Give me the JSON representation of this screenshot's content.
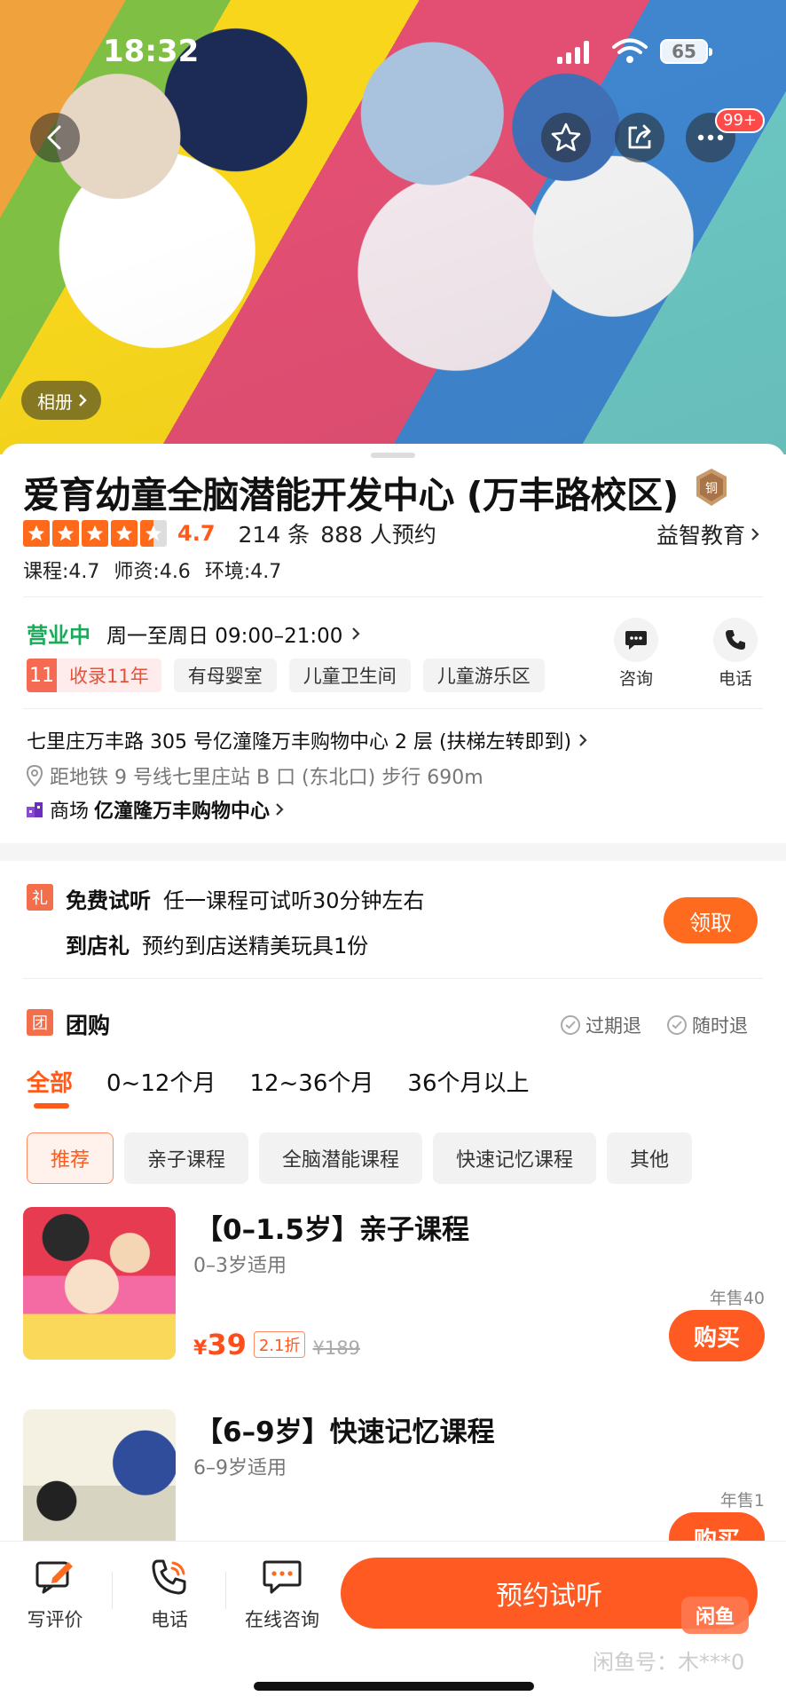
{
  "status_bar": {
    "time": "18:32",
    "battery": "65"
  },
  "header": {
    "notification_badge": "99+",
    "album_label": "相册"
  },
  "shop": {
    "name": "爱育幼童全脑潜能开发中心 (万丰路校区)",
    "medal_label": "铜",
    "rating": "4.7",
    "rating_stars": 4.5,
    "reviews": "214 条",
    "bookings": "888 人预约",
    "category": "益智教育",
    "sub_scores": [
      "课程:4.7",
      "师资:4.6",
      "环境:4.7"
    ],
    "open_status": "营业中",
    "hours": "周一至周日 09:00–21:00",
    "years_num": "11",
    "years_label": "收录11年",
    "tags": [
      "有母婴室",
      "儿童卫生间",
      "儿童游乐区"
    ],
    "consult_label": "咨询",
    "phone_label": "电话",
    "address": "七里庄万丰路 305 号亿潼隆万丰购物中心 2 层 (扶梯左转即到)",
    "subway": "距地铁 9 号线七里庄站 B 口 (东北口) 步行 690m",
    "mall_prefix": "商场",
    "mall_name": "亿潼隆万丰购物中心"
  },
  "promos": {
    "icon_label": "礼",
    "trial_title": "免费试听",
    "trial_desc": "任一课程可试听30分钟左右",
    "gift_title": "到店礼",
    "gift_desc": "预约到店送精美玩具1份",
    "claim_label": "领取"
  },
  "group_buy": {
    "icon_label": "团",
    "title": "团购",
    "guarantee_1": "过期退",
    "guarantee_2": "随时退",
    "age_tabs": [
      "全部",
      "0~12个月",
      "12~36个月",
      "36个月以上"
    ],
    "chips": [
      "推荐",
      "亲子课程",
      "全脑潜能课程",
      "快速记忆课程",
      "其他"
    ]
  },
  "products": [
    {
      "title": "【0–1.5岁】亲子课程",
      "subtitle": "0–3岁适用",
      "sold": "年售40",
      "price_symbol": "¥",
      "price": "39",
      "discount": "2.1折",
      "original": "¥189",
      "buy_label": "购买"
    },
    {
      "title": "【6–9岁】快速记忆课程",
      "subtitle": "6–9岁适用",
      "sold": "年售1",
      "buy_label": "购买"
    }
  ],
  "bottom_bar": {
    "review_label": "写评价",
    "phone_label": "电话",
    "chat_label": "在线咨询",
    "book_label": "预约试听",
    "watermark_logo": "闲鱼",
    "watermark_text": "闲鱼号：木***0"
  },
  "colors": {
    "accent": "#ff5a22",
    "open_green": "#1aab5a",
    "star": "#ff6a1a"
  }
}
